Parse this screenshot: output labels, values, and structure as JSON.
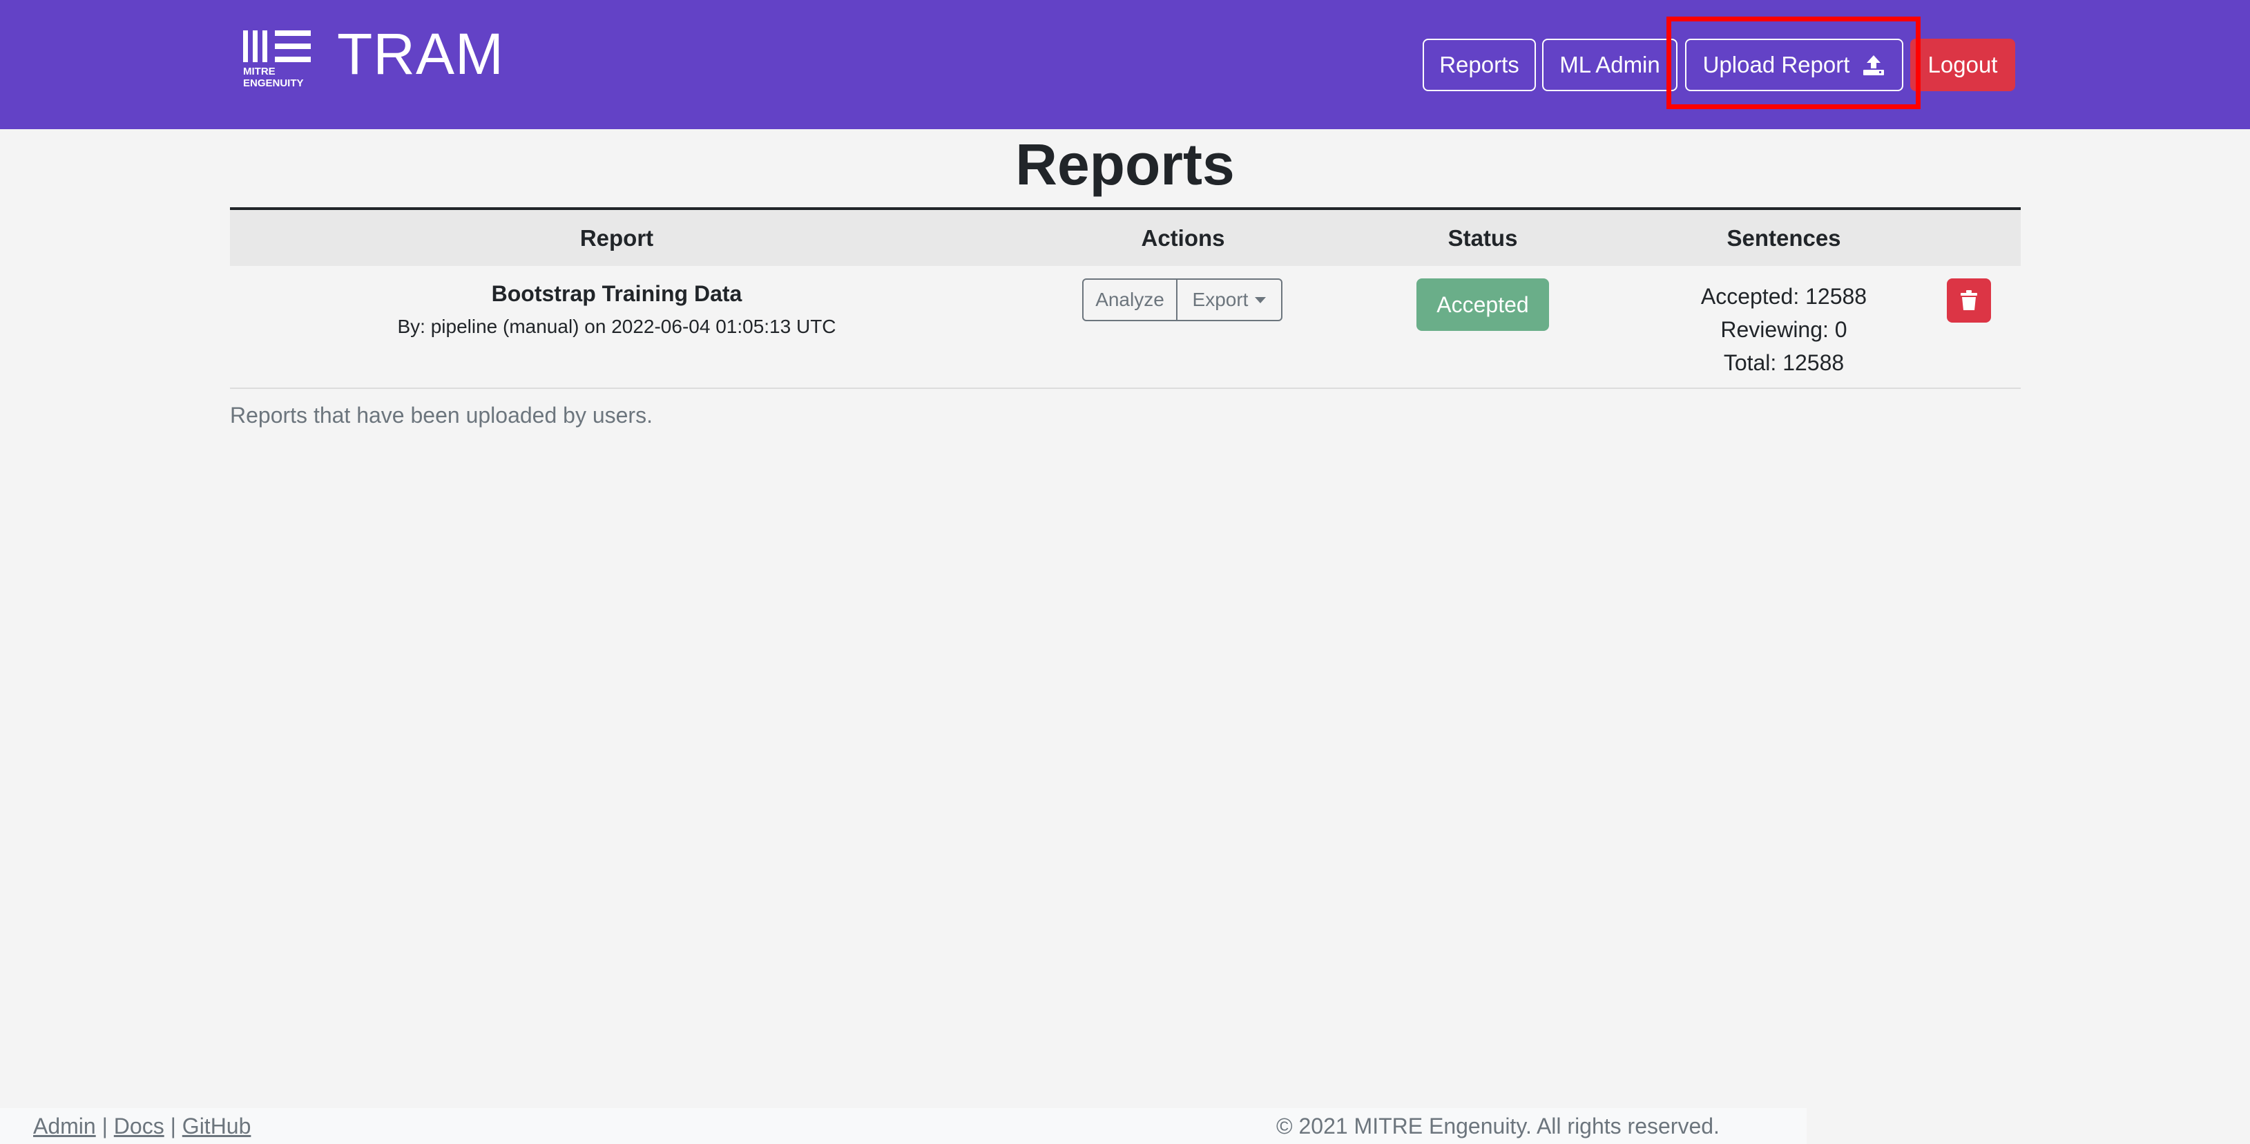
{
  "header": {
    "logo_text": "MITRE ENGENUITY",
    "title": "TRAM",
    "nav": {
      "reports": "Reports",
      "ml_admin": "ML Admin",
      "upload_report": "Upload Report",
      "logout": "Logout"
    },
    "upload_icon": "upload-icon"
  },
  "main": {
    "title": "Reports",
    "table": {
      "columns": [
        "Report",
        "Actions",
        "Status",
        "Sentences",
        ""
      ],
      "rows": [
        {
          "name": "Bootstrap Training Data",
          "byline": "By: pipeline (manual) on 2022-06-04 01:05:13 UTC",
          "actions": {
            "analyze": "Analyze",
            "export": "Export"
          },
          "status": "Accepted",
          "sentences": {
            "accepted": "Accepted: 12588",
            "reviewing": "Reviewing: 0",
            "total": "Total: 12588"
          },
          "delete_icon": "trash-icon"
        }
      ]
    },
    "caption": "Reports that have been uploaded by users."
  },
  "footer": {
    "links": {
      "admin": "Admin",
      "docs": "Docs",
      "github": "GitHub"
    },
    "separator": "|",
    "copyright": "© 2021 MITRE Engenuity. All rights reserved."
  },
  "colors": {
    "navbar": "#6342c6",
    "logout": "#dc3545",
    "accepted_badge": "#6aae89",
    "highlight": "#ff0000"
  }
}
